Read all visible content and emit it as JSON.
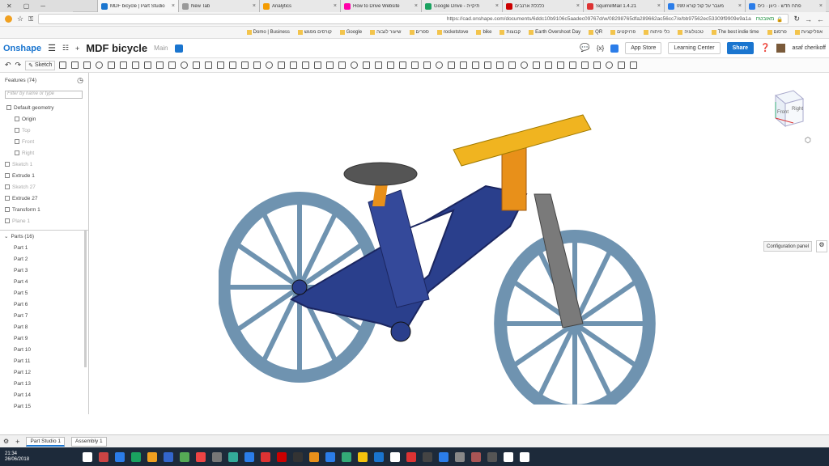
{
  "browser": {
    "tabs": [
      {
        "title": "פתח חדש · כיוון · כיס",
        "color": "#2b7de9"
      },
      {
        "title": "מעבר על קול קורא 090",
        "color": "#2b7de9"
      },
      {
        "title": "SquirrelMail 1.4.21",
        "color": "#d33"
      },
      {
        "title": "כלכלת ארנבים",
        "color": "#c00"
      },
      {
        "title": "Google Drive - תיקייה",
        "color": "#1aa260"
      },
      {
        "title": "How to Drive Website",
        "color": "#f0a"
      },
      {
        "title": "Analytics",
        "color": "#f49b00"
      },
      {
        "title": "New Tab",
        "color": "#999"
      },
      {
        "title": "MDF bicycle | Part Studio",
        "color": "#1a75cf"
      }
    ],
    "url": "https://cad.onshape.com/documents/6ddc10b9106c5aadec09767d/w/08298765dfa289662ac56cc7/e/bb97562ec53309f9909e9a1a",
    "secure_label": "מאובטח",
    "bookmarks": [
      "אפליקציות",
      "פרסום",
      "The best indie time",
      "טכנולוגיה",
      "כלי פיתוח",
      "פרויקטים",
      "QR",
      "Earth Overshoot Day",
      "קבוצות",
      "bike",
      "rocketstove",
      "ספרים",
      "שיעור לגבוה",
      "Google",
      "קורסים מפגש",
      "Domo | Business"
    ]
  },
  "app": {
    "logo": "Onshape",
    "doc_title": "MDF bicycle",
    "workspace": "Main",
    "sketch_label": "Sketch",
    "app_store": "App Store",
    "learning_center": "Learning Center",
    "share": "Share",
    "user": "asaf cherikoff",
    "config_panel": "Configuration panel",
    "cube_front": "Front",
    "cube_right": "Right"
  },
  "features": {
    "header": "Features (74)",
    "filter_placeholder": "Filter by name or type",
    "items": [
      {
        "label": "Default geometry",
        "dim": false
      },
      {
        "label": "Origin",
        "dim": false
      },
      {
        "label": "Top",
        "dim": true
      },
      {
        "label": "Front",
        "dim": true
      },
      {
        "label": "Right",
        "dim": true
      },
      {
        "label": "Sketch 1",
        "dim": true
      },
      {
        "label": "Extrude 1",
        "dim": false
      },
      {
        "label": "Sketch 27",
        "dim": true
      },
      {
        "label": "Extrude 27",
        "dim": false
      },
      {
        "label": "Transform 1",
        "dim": false
      },
      {
        "label": "Plane 1",
        "dim": true
      }
    ]
  },
  "parts": {
    "header": "Parts (16)",
    "items": [
      "Part 1",
      "Part 2",
      "Part 3",
      "Part 4",
      "Part 5",
      "Part 6",
      "Part 7",
      "Part 8",
      "Part 9",
      "Part 10",
      "Part 11",
      "Part 12",
      "Part 13",
      "Part 14",
      "Part 15"
    ]
  },
  "bottom_tabs": [
    "Part Studio 1",
    "Assembly 1"
  ],
  "clock": {
    "time": "21:34",
    "date": "26/06/2018"
  },
  "colors": {
    "frame": "#2a3f8c",
    "wheel": "#6f93b0",
    "gear": "#f0b420",
    "orange": "#e8901a",
    "grey": "#7a7a7a"
  }
}
